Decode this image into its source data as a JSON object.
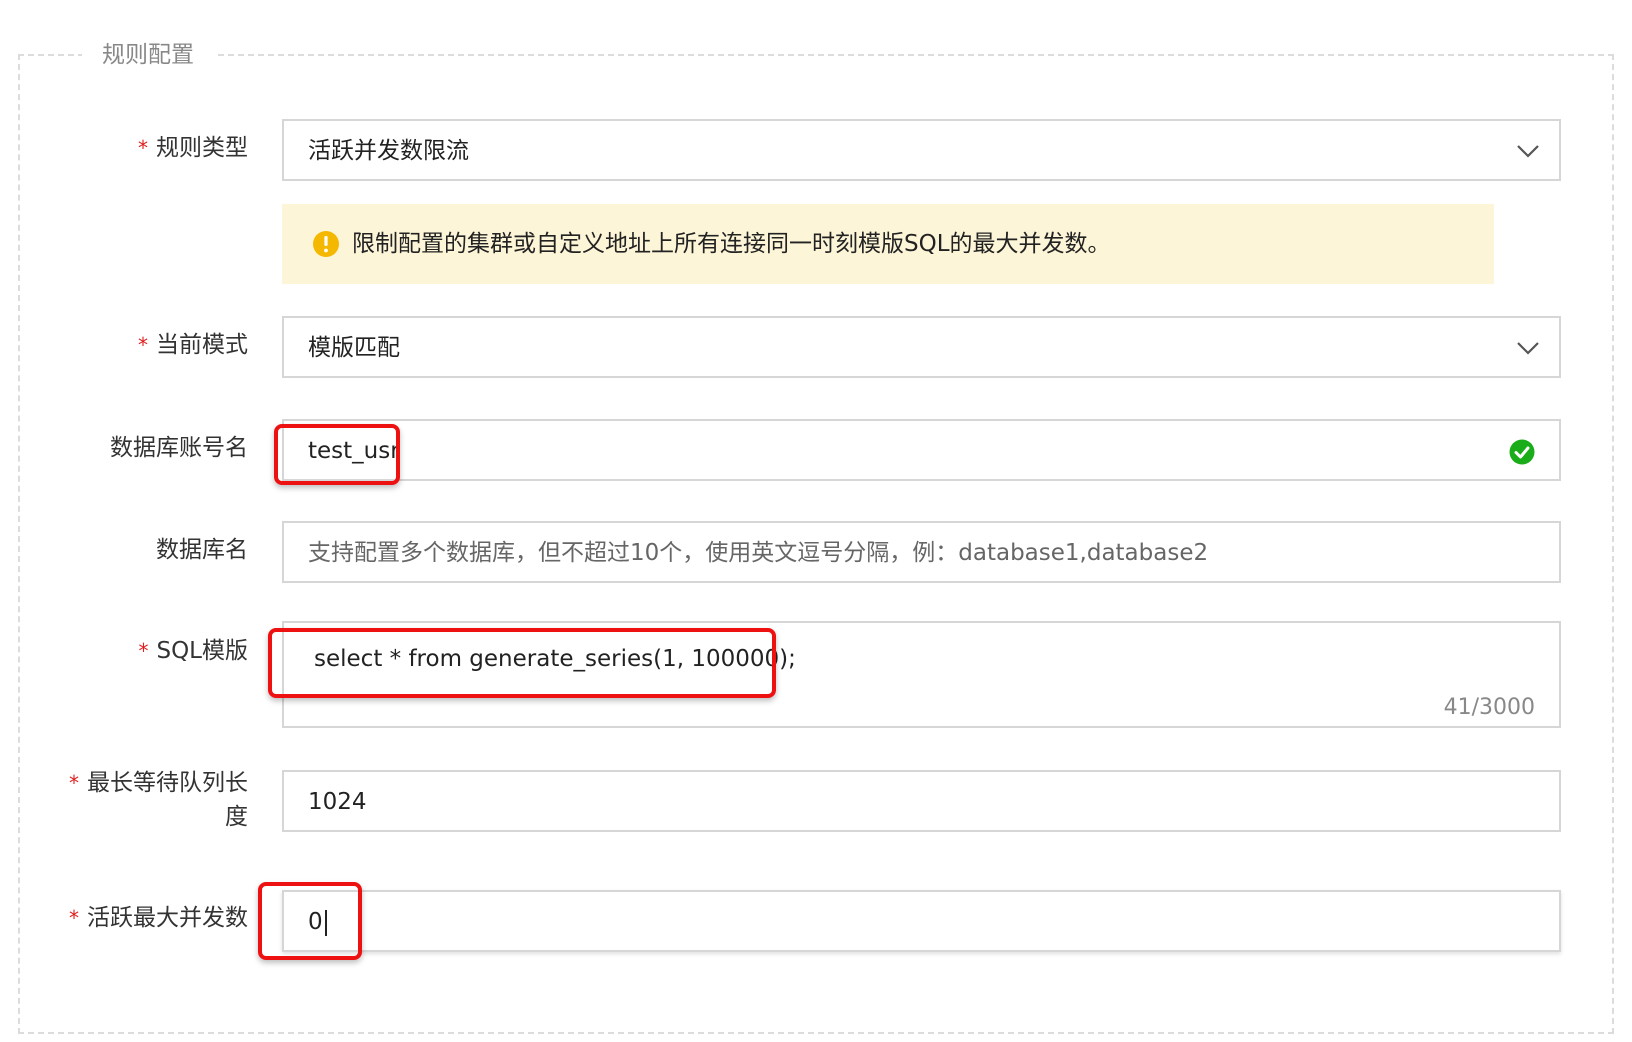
{
  "section": {
    "legend": "规则配置"
  },
  "required_marker": "*",
  "rule_type": {
    "label": "规则类型",
    "value": "活跃并发数限流"
  },
  "notice": {
    "icon": "warning-icon",
    "text": "限制配置的集群或自定义地址上所有连接同一时刻模版SQL的最大并发数。",
    "background": "#fdf5d8"
  },
  "mode": {
    "label": "当前模式",
    "value": "模版匹配"
  },
  "db_account": {
    "label": "数据库账号名",
    "value": "test_usr",
    "status_icon": "check-circle-icon"
  },
  "db_name": {
    "label": "数据库名",
    "placeholder": "支持配置多个数据库，但不超过10个，使用英文逗号分隔，例：database1,database2"
  },
  "sql_template": {
    "label": "SQL模版",
    "value": "select * from generate_series(1, 100000);",
    "counter": "41/3000"
  },
  "max_queue": {
    "label_line1": "最长等待队列长",
    "label_line2": "度",
    "value": "1024"
  },
  "max_concurrency": {
    "label": "活跃最大并发数",
    "value": "0"
  },
  "colors": {
    "required": "#e02020",
    "highlight": "#ee1111",
    "success": "#1aad19",
    "warning": "#f5b800"
  }
}
